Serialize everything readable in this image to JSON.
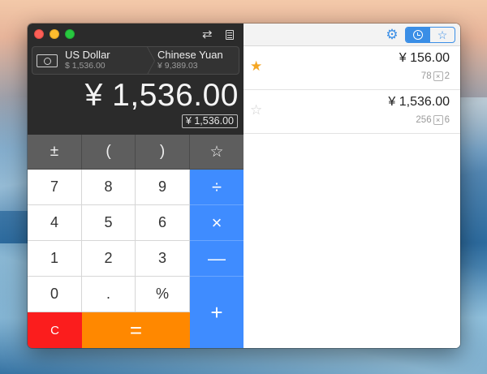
{
  "window": {
    "controls": [
      "close",
      "minimize",
      "zoom"
    ]
  },
  "toolbar": {
    "swap_icon": "⇄",
    "doc_icon": "document-icon"
  },
  "pair": {
    "from_name": "US Dollar",
    "from_amount": "$ 1,536.00",
    "to_name": "Chinese Yuan",
    "to_amount": "¥ 9,389.03"
  },
  "display": {
    "main": "¥ 1,536.00",
    "sub": "¥ 1,536.00"
  },
  "keys": {
    "plus_minus": "±",
    "open_paren": "(",
    "close_paren": ")",
    "star": "☆",
    "seven": "7",
    "eight": "8",
    "nine": "9",
    "divide": "÷",
    "four": "4",
    "five": "5",
    "six": "6",
    "multiply": "×",
    "one": "1",
    "two": "2",
    "three": "3",
    "minus": "—",
    "zero": "0",
    "dot": ".",
    "percent": "%",
    "plus": "+",
    "clear": "C",
    "equals": "="
  },
  "history_toolbar": {
    "gear": "⚙",
    "star": "☆",
    "active_tab": "history"
  },
  "history": [
    {
      "starred": true,
      "amount": "¥  156.00",
      "left": "78",
      "op": "×",
      "right": "2"
    },
    {
      "starred": false,
      "amount": "¥  1,536.00",
      "left": "256",
      "op": "×",
      "right": "6"
    }
  ],
  "colors": {
    "operator": "#3f8cff",
    "clear": "#fb1d1d",
    "equals": "#ff8800",
    "accent": "#3a8ee6",
    "star_on": "#f5a623"
  }
}
